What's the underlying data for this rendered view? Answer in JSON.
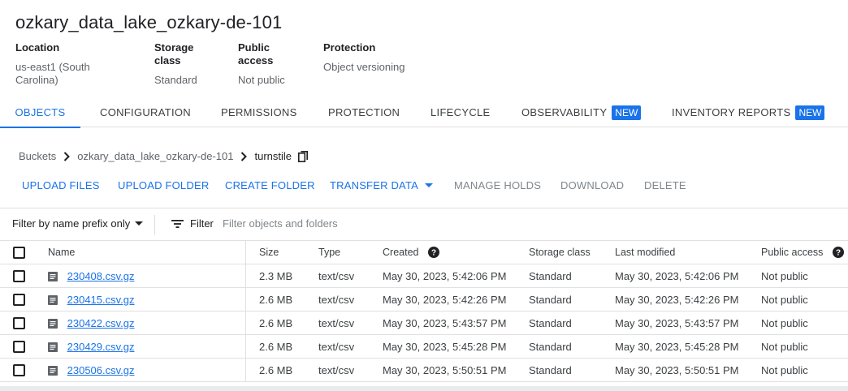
{
  "bucket": {
    "title": "ozkary_data_lake_ozkary-de-101",
    "meta": [
      {
        "label": "Location",
        "value": "us-east1 (South Carolina)"
      },
      {
        "label": "Storage class",
        "value": "Standard"
      },
      {
        "label": "Public access",
        "value": "Not public"
      },
      {
        "label": "Protection",
        "value": "Object versioning"
      }
    ]
  },
  "tabs": [
    {
      "label": "OBJECTS",
      "active": true
    },
    {
      "label": "CONFIGURATION"
    },
    {
      "label": "PERMISSIONS"
    },
    {
      "label": "PROTECTION"
    },
    {
      "label": "LIFECYCLE"
    },
    {
      "label": "OBSERVABILITY",
      "badge": "NEW"
    },
    {
      "label": "INVENTORY REPORTS",
      "badge": "NEW"
    }
  ],
  "breadcrumb": {
    "root": "Buckets",
    "bucket": "ozkary_data_lake_ozkary-de-101",
    "folder": "turnstile",
    "copy_icon": "copy-icon"
  },
  "actions": {
    "upload_files": "UPLOAD FILES",
    "upload_folder": "UPLOAD FOLDER",
    "create_folder": "CREATE FOLDER",
    "transfer_data": "TRANSFER DATA",
    "manage_holds": "MANAGE HOLDS",
    "download": "DOWNLOAD",
    "delete": "DELETE"
  },
  "filter": {
    "prefix_label": "Filter by name prefix only",
    "filter_label": "Filter",
    "placeholder": "Filter objects and folders"
  },
  "table": {
    "columns": {
      "name": "Name",
      "size": "Size",
      "type": "Type",
      "created": "Created",
      "storage_class": "Storage class",
      "last_modified": "Last modified",
      "public_access": "Public access"
    },
    "rows": [
      {
        "name": "230408.csv.gz",
        "size": "2.3 MB",
        "type": "text/csv",
        "created": "May 30, 2023, 5:42:06 PM",
        "storage_class": "Standard",
        "last_modified": "May 30, 2023, 5:42:06 PM",
        "public_access": "Not public"
      },
      {
        "name": "230415.csv.gz",
        "size": "2.6 MB",
        "type": "text/csv",
        "created": "May 30, 2023, 5:42:26 PM",
        "storage_class": "Standard",
        "last_modified": "May 30, 2023, 5:42:26 PM",
        "public_access": "Not public"
      },
      {
        "name": "230422.csv.gz",
        "size": "2.6 MB",
        "type": "text/csv",
        "created": "May 30, 2023, 5:43:57 PM",
        "storage_class": "Standard",
        "last_modified": "May 30, 2023, 5:43:57 PM",
        "public_access": "Not public"
      },
      {
        "name": "230429.csv.gz",
        "size": "2.6 MB",
        "type": "text/csv",
        "created": "May 30, 2023, 5:45:28 PM",
        "storage_class": "Standard",
        "last_modified": "May 30, 2023, 5:45:28 PM",
        "public_access": "Not public"
      },
      {
        "name": "230506.csv.gz",
        "size": "2.6 MB",
        "type": "text/csv",
        "created": "May 30, 2023, 5:50:51 PM",
        "storage_class": "Standard",
        "last_modified": "May 30, 2023, 5:50:51 PM",
        "public_access": "Not public"
      }
    ]
  },
  "colors": {
    "accent": "#1a73e8",
    "text": "#202124",
    "muted": "#5f6368",
    "disabled": "#80868b",
    "border": "#e0e0e0"
  }
}
